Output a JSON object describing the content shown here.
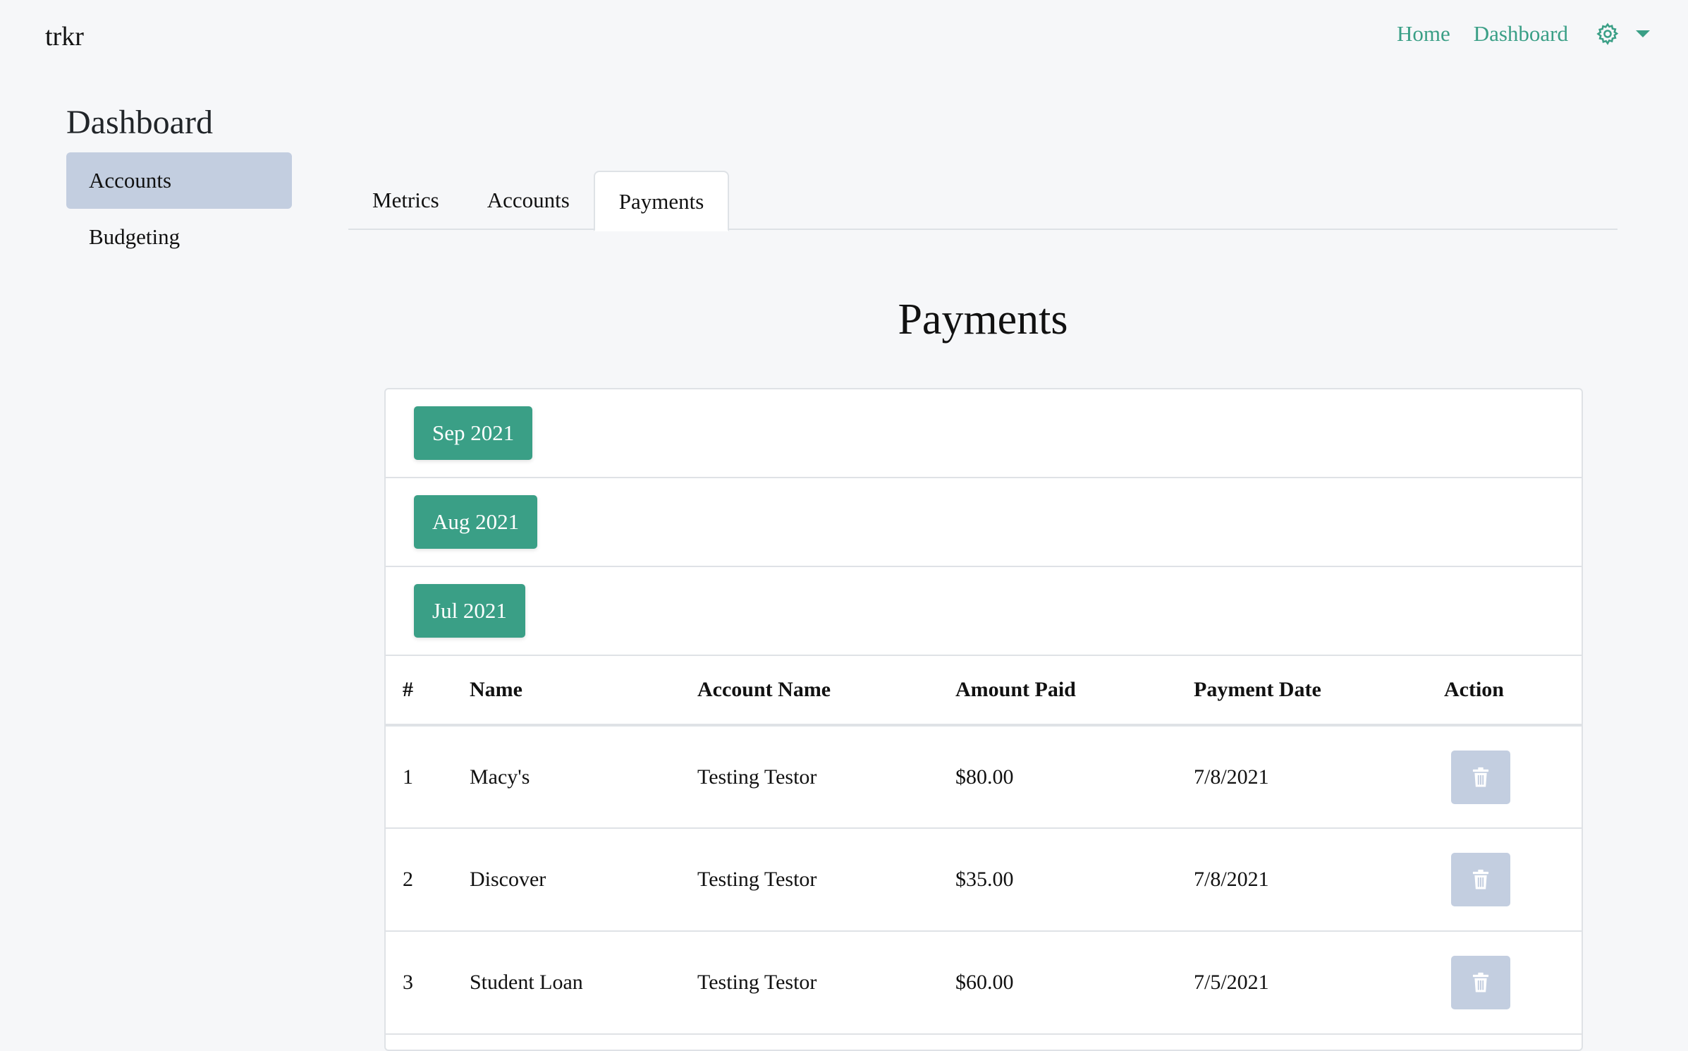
{
  "topbar": {
    "brand": "trkr",
    "links": [
      "Home",
      "Dashboard"
    ],
    "settings_icon": "gear-icon",
    "menu_icon": "caret-down-icon",
    "accent_color": "#3a9f86"
  },
  "sidebar": {
    "heading": "Dashboard",
    "items": [
      {
        "label": "Accounts",
        "active": true
      },
      {
        "label": "Budgeting",
        "active": false
      }
    ]
  },
  "tabs": [
    {
      "label": "Metrics",
      "active": false
    },
    {
      "label": "Accounts",
      "active": false
    },
    {
      "label": "Payments",
      "active": true
    }
  ],
  "main": {
    "title": "Payments",
    "months": [
      "Sep 2021",
      "Aug 2021",
      "Jul 2021"
    ],
    "table": {
      "headers": [
        "#",
        "Name",
        "Account Name",
        "Amount Paid",
        "Payment Date",
        "Action"
      ],
      "rows": [
        {
          "num": "1",
          "name": "Macy's",
          "account": "Testing Testor",
          "amount": "$80.00",
          "date": "7/8/2021"
        },
        {
          "num": "2",
          "name": "Discover",
          "account": "Testing Testor",
          "amount": "$35.00",
          "date": "7/8/2021"
        },
        {
          "num": "3",
          "name": "Student Loan",
          "account": "Testing Testor",
          "amount": "$60.00",
          "date": "7/5/2021"
        }
      ],
      "action_icon": "trash-icon"
    }
  }
}
